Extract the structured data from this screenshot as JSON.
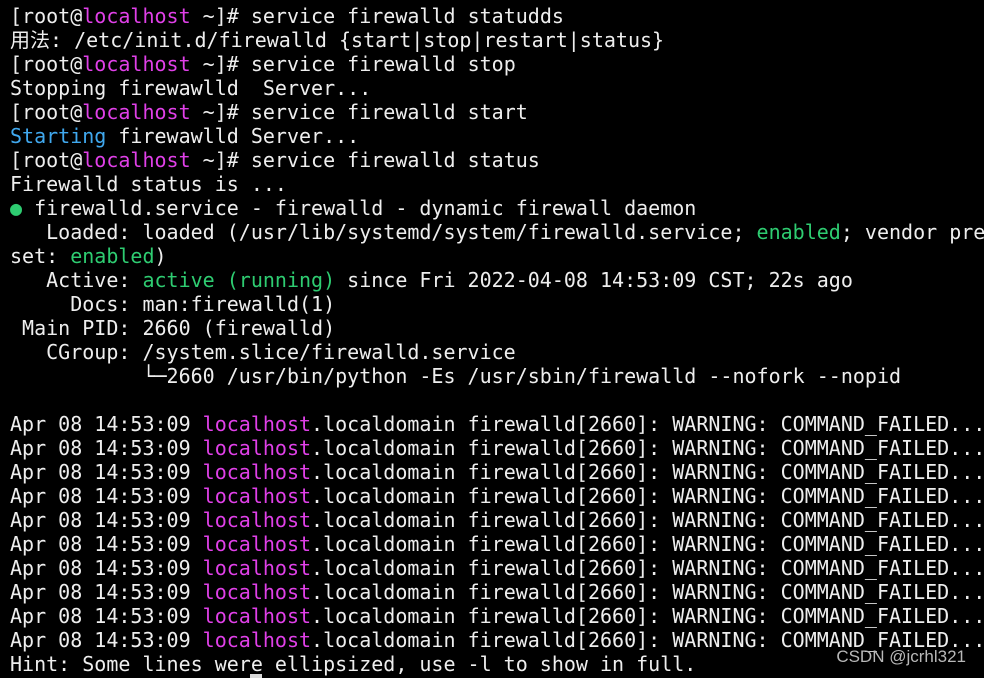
{
  "terminal": {
    "colors": {
      "background": "#000000",
      "text": "#eeeeee",
      "hostname": "#e040e8",
      "starting": "#40a8ee",
      "status_green": "#2ecc71"
    },
    "lines": [
      {
        "type": "prompt",
        "segments": [
          "[root@",
          "localhost",
          " ~]# service firewalld statudds"
        ]
      },
      {
        "type": "output",
        "segments": [
          "用法: /etc/init.d/firewalld {start|stop|restart|status}"
        ]
      },
      {
        "type": "prompt",
        "segments": [
          "[root@",
          "localhost",
          " ~]# service firewalld stop"
        ]
      },
      {
        "type": "output",
        "segments": [
          "Stopping firewawlld  Server..."
        ]
      },
      {
        "type": "prompt",
        "segments": [
          "[root@",
          "localhost",
          " ~]# service firewalld start"
        ]
      },
      {
        "type": "starting",
        "segments": [
          "Starting",
          " firewawlld Server..."
        ]
      },
      {
        "type": "prompt",
        "segments": [
          "[root@",
          "localhost",
          " ~]# service firewalld status"
        ]
      },
      {
        "type": "output",
        "segments": [
          "Firewalld status is ..."
        ]
      },
      {
        "type": "service",
        "segments": [
          "●",
          " firewalld.service - firewalld - dynamic firewall daemon"
        ]
      },
      {
        "type": "loaded",
        "segments": [
          "   Loaded: loaded (/usr/lib/systemd/system/firewalld.service; ",
          "enabled",
          "; vendor pre"
        ]
      },
      {
        "type": "wrap",
        "segments": [
          "set: ",
          "enabled",
          ")"
        ]
      },
      {
        "type": "active",
        "segments": [
          "   Active: ",
          "active (running)",
          " since Fri 2022-04-08 14:53:09 CST; 22s ago"
        ]
      },
      {
        "type": "output",
        "segments": [
          "     Docs: man:firewalld(1)"
        ]
      },
      {
        "type": "output",
        "segments": [
          " Main PID: 2660 (firewalld)"
        ]
      },
      {
        "type": "output",
        "segments": [
          "   CGroup: /system.slice/firewalld.service"
        ]
      },
      {
        "type": "output",
        "segments": [
          "           └─2660 /usr/bin/python -Es /usr/sbin/firewalld --nofork --nopid"
        ]
      },
      {
        "type": "blank",
        "segments": [
          ""
        ]
      },
      {
        "type": "log",
        "segments": [
          "Apr 08 14:53:09 ",
          "localhost",
          ".localdomain firewalld[2660]: WARNING: COMMAND_FAILED..."
        ]
      },
      {
        "type": "log",
        "segments": [
          "Apr 08 14:53:09 ",
          "localhost",
          ".localdomain firewalld[2660]: WARNING: COMMAND_FAILED..."
        ]
      },
      {
        "type": "log",
        "segments": [
          "Apr 08 14:53:09 ",
          "localhost",
          ".localdomain firewalld[2660]: WARNING: COMMAND_FAILED..."
        ]
      },
      {
        "type": "log",
        "segments": [
          "Apr 08 14:53:09 ",
          "localhost",
          ".localdomain firewalld[2660]: WARNING: COMMAND_FAILED..."
        ]
      },
      {
        "type": "log",
        "segments": [
          "Apr 08 14:53:09 ",
          "localhost",
          ".localdomain firewalld[2660]: WARNING: COMMAND_FAILED..."
        ]
      },
      {
        "type": "log",
        "segments": [
          "Apr 08 14:53:09 ",
          "localhost",
          ".localdomain firewalld[2660]: WARNING: COMMAND_FAILED..."
        ]
      },
      {
        "type": "log",
        "segments": [
          "Apr 08 14:53:09 ",
          "localhost",
          ".localdomain firewalld[2660]: WARNING: COMMAND_FAILED..."
        ]
      },
      {
        "type": "log",
        "segments": [
          "Apr 08 14:53:09 ",
          "localhost",
          ".localdomain firewalld[2660]: WARNING: COMMAND_FAILED..."
        ]
      },
      {
        "type": "log",
        "segments": [
          "Apr 08 14:53:09 ",
          "localhost",
          ".localdomain firewalld[2660]: WARNING: COMMAND_FAILED..."
        ]
      },
      {
        "type": "log",
        "segments": [
          "Apr 08 14:53:09 ",
          "localhost",
          ".localdomain firewalld[2660]: WARNING: COMMAND_FAILED..."
        ]
      },
      {
        "type": "output",
        "segments": [
          "Hint: Some lines were ellipsized, use -l to show in full."
        ]
      }
    ]
  },
  "watermark": {
    "text": "CSDN @jcrhl321"
  }
}
